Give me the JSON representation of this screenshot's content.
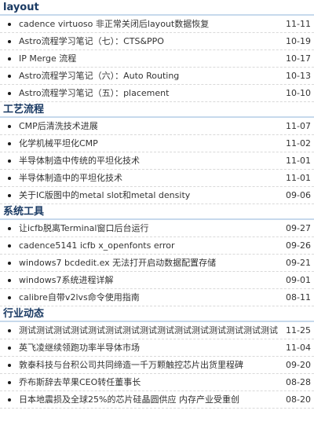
{
  "sections": [
    {
      "title": "layout",
      "items": [
        {
          "title": "cadence virtuoso 非正常关闭后layout数据恢复",
          "date": "11-11"
        },
        {
          "title": "Astro流程学习笔记（七）：CTS&PPO",
          "date": "10-19"
        },
        {
          "title": "IP Merge 流程",
          "date": "10-17"
        },
        {
          "title": "Astro流程学习笔记（六）：Auto Routing",
          "date": "10-13"
        },
        {
          "title": "Astro流程学习笔记（五）：placement",
          "date": "10-10"
        }
      ]
    },
    {
      "title": "工艺流程",
      "items": [
        {
          "title": "CMP后清洗技术进展",
          "date": "11-07"
        },
        {
          "title": "化学机械平坦化CMP",
          "date": "11-02"
        },
        {
          "title": "半导体制造中传统的平坦化技术",
          "date": "11-01"
        },
        {
          "title": "半导体制造中的平坦化技术",
          "date": "11-01"
        },
        {
          "title": "关于IC版图中的metal slot和metal density",
          "date": "09-06"
        }
      ]
    },
    {
      "title": "系统工具",
      "items": [
        {
          "title": "让icfb脱离Terminal窗口后台运行",
          "date": "09-27"
        },
        {
          "title": "cadence5141 icfb x_openfonts error",
          "date": "09-26"
        },
        {
          "title": "windows7 bcdedit.ex 无法打开启动数据配置存储",
          "date": "09-21"
        },
        {
          "title": "windows7系统进程详解",
          "date": "09-01"
        },
        {
          "title": "calibre自带v2lvs命令使用指南",
          "date": "08-11"
        }
      ]
    },
    {
      "title": "行业动态",
      "items": [
        {
          "title": "测试测试测试测试测试测试测试测试测试测试测试测试测试测试测试",
          "date": "11-25"
        },
        {
          "title": "英飞凌继续领跑功率半导体市场",
          "date": "11-04"
        },
        {
          "title": "敦泰科技与台积公司共同缔造一千万颗触控芯片出货里程碑",
          "date": "09-20"
        },
        {
          "title": "乔布斯辞去苹果CEO转任董事长",
          "date": "08-28"
        },
        {
          "title": "日本地震损及全球25%的芯片硅晶圆供应 内存产业受重创",
          "date": "08-20"
        }
      ]
    }
  ]
}
